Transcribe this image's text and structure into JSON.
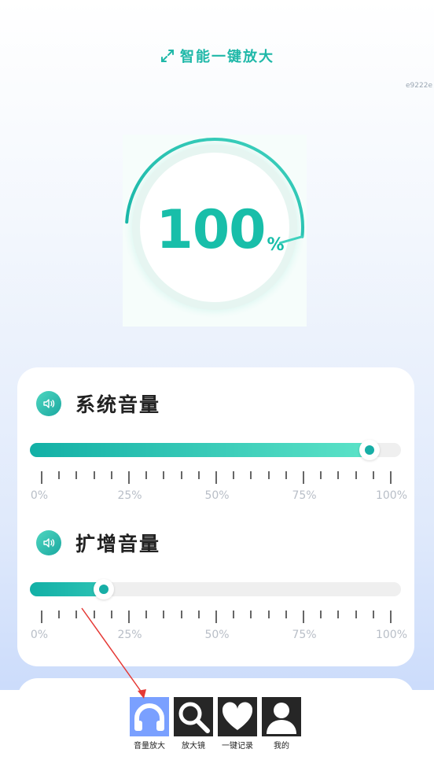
{
  "header": {
    "title": "智能一键放大",
    "icon": "expand-icon"
  },
  "corner_id": "e9222e",
  "dial": {
    "value": "100",
    "unit": "%",
    "level": 0.83
  },
  "system_volume": {
    "title": "系统音量",
    "icon": "speaker-icon",
    "value_fraction": 0.916,
    "ticks": [
      "0%",
      "25%",
      "50%",
      "75%",
      "100%"
    ]
  },
  "boost_volume": {
    "title": "扩增音量",
    "icon": "speaker-icon",
    "value_fraction": 0.2,
    "ticks": [
      "0%",
      "25%",
      "50%",
      "75%",
      "100%"
    ]
  },
  "nav": {
    "items": [
      {
        "label": "音量放大",
        "icon": "headphones-icon",
        "active": true
      },
      {
        "label": "放大镜",
        "icon": "magnifier-icon",
        "active": false
      },
      {
        "label": "一键记录",
        "icon": "heart-icon",
        "active": false
      },
      {
        "label": "我的",
        "icon": "person-icon",
        "active": false
      }
    ]
  },
  "colors": {
    "accent": "#18bea9",
    "nav_active": "#7aa0ff",
    "annotation_arrow": "#e53935"
  }
}
